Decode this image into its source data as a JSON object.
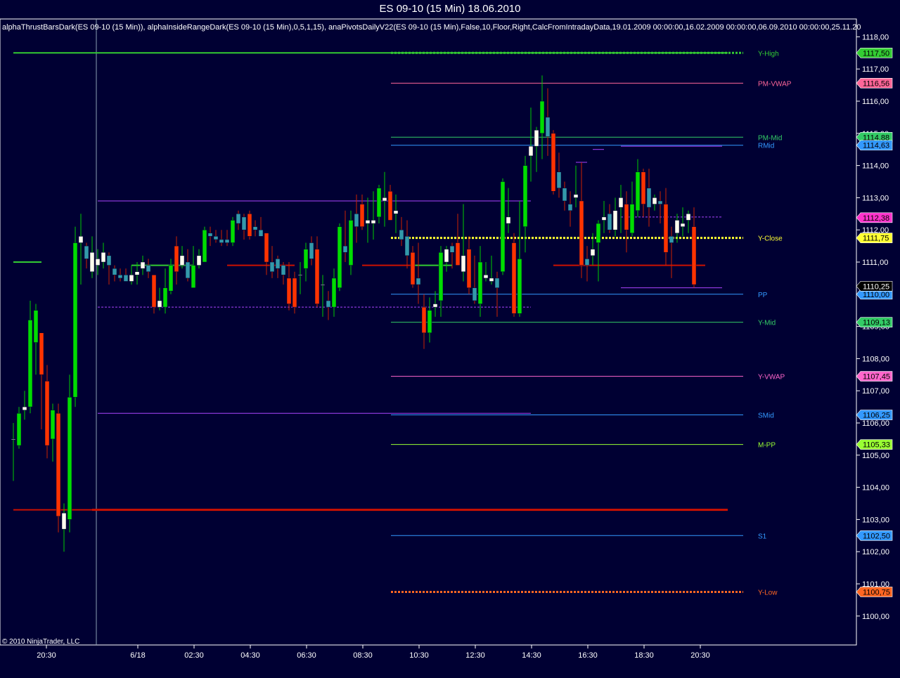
{
  "window": {
    "title": "ES 09-10 (15 Min)  18.06.2010",
    "indicator_line": "alphaThrustBarsDark(ES 09-10 (15 Min)), alphaInsideRangeDark(ES 09-10 (15 Min),0,5,1,15), anaPivotsDailyV22(ES 09-10 (15 Min),False,10,Floor,Right,CalcFromIntradayData,19.01.2009 00:00:00,16.02.2009 00:00:00,06.09.2010 00:00:00,25.11.20",
    "copyright": "© 2010 NinjaTrader, LLC"
  },
  "colors": {
    "background": "#000033",
    "axis_text": "#ffffff",
    "up_bar": "#00dd00",
    "down_bar": "#ff3300",
    "inside_up": "#ffffee",
    "neutral_bar": "#3399aa",
    "pivot_levels": {
      "Y-High": "#33cc33",
      "PM-VWAP": "#ff6699",
      "PM-Mid": "#33cc66",
      "RMid": "#3399ff",
      "Y-Close": "#ffff33",
      "PP": "#3399ff",
      "Y-Mid": "#33cc66",
      "Y-VWAP": "#ff66cc",
      "SMid": "#3399ff",
      "M-PP": "#99ff33",
      "S1": "#3399ff",
      "Y-Low": "#ff6622"
    }
  },
  "chart_data": {
    "type": "candlestick",
    "title": "ES 09-10 (15 Min)  18.06.2010",
    "ylim": [
      1099.0,
      1118.3
    ],
    "y_ticks": [
      "1118,00",
      "1117,00",
      "1116,00",
      "1115,00",
      "1114,00",
      "1113,00",
      "1112,00",
      "1111,00",
      "1110,00",
      "1109,00",
      "1108,00",
      "1107,00",
      "1106,00",
      "1105,00",
      "1104,00",
      "1103,00",
      "1102,00",
      "1101,00",
      "1100,00"
    ],
    "x_ticks": [
      "20:30",
      "6/18",
      "02:30",
      "04:30",
      "06:30",
      "08:30",
      "10:30",
      "12:30",
      "14:30",
      "16:30",
      "18:30",
      "20:30"
    ],
    "pivot_levels": [
      {
        "name": "Y-High",
        "value": 1117.5,
        "price_label": "1117,50"
      },
      {
        "name": "PM-VWAP",
        "value": 1116.56,
        "price_label": "1116,56"
      },
      {
        "name": "PM-Mid",
        "value": 1114.88,
        "price_label": "1114,88"
      },
      {
        "name": "RMid",
        "value": 1114.63,
        "price_label": "1114,63"
      },
      {
        "name": "Y-Close",
        "value": 1111.75,
        "price_label": "1111,75"
      },
      {
        "name": "PP",
        "value": 1110.0,
        "price_label": "1110,00"
      },
      {
        "name": "Y-Mid",
        "value": 1109.13,
        "price_label": "1109,13"
      },
      {
        "name": "Y-VWAP",
        "value": 1107.45,
        "price_label": "1107,45"
      },
      {
        "name": "SMid",
        "value": 1106.25,
        "price_label": "1106,25"
      },
      {
        "name": "M-PP",
        "value": 1105.33,
        "price_label": "1105,33"
      },
      {
        "name": "S1",
        "value": 1102.5,
        "price_label": "1102,50"
      },
      {
        "name": "Y-Low",
        "value": 1100.75,
        "price_label": "1100,75"
      }
    ],
    "extra_price_labels": [
      {
        "value": 1112.38,
        "price_label": "1112,38",
        "color": "#ff33cc"
      },
      {
        "value": 1110.25,
        "price_label": "1110,25",
        "color": "#000000"
      }
    ],
    "candles": [
      {
        "o": 1105.5,
        "h": 1106.0,
        "l": 1104.2,
        "c": 1105.5
      },
      {
        "o": 1105.3,
        "h": 1106.5,
        "l": 1105.2,
        "c": 1106.3
      },
      {
        "o": 1106.4,
        "h": 1107.0,
        "l": 1106.1,
        "c": 1106.5
      },
      {
        "o": 1106.5,
        "h": 1109.8,
        "l": 1106.3,
        "c": 1109.2
      },
      {
        "o": 1108.5,
        "h": 1109.7,
        "l": 1107.5,
        "c": 1109.5
      },
      {
        "o": 1108.8,
        "h": 1108.5,
        "l": 1105.8,
        "c": 1107.5
      },
      {
        "o": 1107.3,
        "h": 1107.8,
        "l": 1104.9,
        "c": 1105.3
      },
      {
        "o": 1105.5,
        "h": 1106.6,
        "l": 1104.8,
        "c": 1106.4
      },
      {
        "o": 1106.3,
        "h": 1106.6,
        "l": 1102.6,
        "c": 1103.1
      },
      {
        "o": 1102.7,
        "h": 1103.5,
        "l": 1102.0,
        "c": 1103.2
      },
      {
        "o": 1103.0,
        "h": 1107.5,
        "l": 1102.6,
        "c": 1106.8
      },
      {
        "o": 1106.8,
        "h": 1112.1,
        "l": 1106.5,
        "c": 1111.6
      },
      {
        "o": 1111.6,
        "h": 1112.5,
        "l": 1110.3,
        "c": 1111.8
      },
      {
        "o": 1111.5,
        "h": 1111.6,
        "l": 1110.8,
        "c": 1111.1
      },
      {
        "o": 1110.7,
        "h": 1111.8,
        "l": 1110.5,
        "c": 1111.3
      },
      {
        "o": 1110.9,
        "h": 1111.4,
        "l": 1110.6,
        "c": 1111.1
      },
      {
        "o": 1111.0,
        "h": 1111.6,
        "l": 1110.8,
        "c": 1111.3
      },
      {
        "o": 1111.2,
        "h": 1111.3,
        "l": 1110.3,
        "c": 1110.9
      },
      {
        "o": 1110.8,
        "h": 1110.9,
        "l": 1110.4,
        "c": 1110.6
      },
      {
        "o": 1110.6,
        "h": 1110.8,
        "l": 1110.4,
        "c": 1110.5
      },
      {
        "o": 1110.6,
        "h": 1110.8,
        "l": 1110.4,
        "c": 1110.4
      },
      {
        "o": 1110.4,
        "h": 1110.9,
        "l": 1110.3,
        "c": 1110.6
      },
      {
        "o": 1110.6,
        "h": 1111.0,
        "l": 1110.3,
        "c": 1110.7
      },
      {
        "o": 1110.8,
        "h": 1111.2,
        "l": 1110.6,
        "c": 1111.0
      },
      {
        "o": 1110.9,
        "h": 1111.1,
        "l": 1110.5,
        "c": 1110.7
      },
      {
        "o": 1110.6,
        "h": 1110.6,
        "l": 1109.4,
        "c": 1109.6
      },
      {
        "o": 1109.6,
        "h": 1110.2,
        "l": 1109.5,
        "c": 1109.8
      },
      {
        "o": 1109.6,
        "h": 1110.8,
        "l": 1109.4,
        "c": 1110.2
      },
      {
        "o": 1110.1,
        "h": 1111.1,
        "l": 1110.0,
        "c": 1110.9
      },
      {
        "o": 1111.5,
        "h": 1111.8,
        "l": 1110.3,
        "c": 1110.7
      },
      {
        "o": 1110.9,
        "h": 1111.5,
        "l": 1110.8,
        "c": 1111.2
      },
      {
        "o": 1111.0,
        "h": 1111.4,
        "l": 1110.4,
        "c": 1110.5
      },
      {
        "o": 1110.2,
        "h": 1111.5,
        "l": 1110.2,
        "c": 1110.9
      },
      {
        "o": 1110.9,
        "h": 1111.4,
        "l": 1110.8,
        "c": 1111.2
      },
      {
        "o": 1111.0,
        "h": 1112.1,
        "l": 1111.0,
        "c": 1112.0
      },
      {
        "o": 1111.9,
        "h": 1112.1,
        "l": 1111.5,
        "c": 1111.8
      },
      {
        "o": 1111.8,
        "h": 1112.0,
        "l": 1111.6,
        "c": 1111.7
      },
      {
        "o": 1111.7,
        "h": 1112.0,
        "l": 1111.5,
        "c": 1111.6
      },
      {
        "o": 1111.7,
        "h": 1112.0,
        "l": 1111.5,
        "c": 1111.6
      },
      {
        "o": 1111.6,
        "h": 1112.4,
        "l": 1111.5,
        "c": 1112.3
      },
      {
        "o": 1112.5,
        "h": 1112.6,
        "l": 1112.0,
        "c": 1112.2
      },
      {
        "o": 1112.4,
        "h": 1112.5,
        "l": 1111.7,
        "c": 1112.0
      },
      {
        "o": 1112.5,
        "h": 1112.6,
        "l": 1111.7,
        "c": 1111.8
      },
      {
        "o": 1112.1,
        "h": 1112.3,
        "l": 1111.8,
        "c": 1112.0
      },
      {
        "o": 1112.0,
        "h": 1112.4,
        "l": 1111.8,
        "c": 1111.8
      },
      {
        "o": 1111.9,
        "h": 1111.9,
        "l": 1110.6,
        "c": 1111.0
      },
      {
        "o": 1111.0,
        "h": 1111.5,
        "l": 1110.5,
        "c": 1110.7
      },
      {
        "o": 1111.1,
        "h": 1111.2,
        "l": 1110.5,
        "c": 1110.8
      },
      {
        "o": 1110.9,
        "h": 1111.0,
        "l": 1110.3,
        "c": 1110.6
      },
      {
        "o": 1110.5,
        "h": 1111.0,
        "l": 1109.5,
        "c": 1109.7
      },
      {
        "o": 1110.5,
        "h": 1110.7,
        "l": 1109.4,
        "c": 1109.6
      },
      {
        "o": 1110.6,
        "h": 1111.0,
        "l": 1110.0,
        "c": 1110.6
      },
      {
        "o": 1110.8,
        "h": 1111.6,
        "l": 1110.4,
        "c": 1111.4
      },
      {
        "o": 1111.6,
        "h": 1111.8,
        "l": 1110.9,
        "c": 1111.1
      },
      {
        "o": 1111.4,
        "h": 1111.8,
        "l": 1109.6,
        "c": 1109.7
      },
      {
        "o": 1110.3,
        "h": 1110.6,
        "l": 1109.3,
        "c": 1110.3
      },
      {
        "o": 1109.8,
        "h": 1110.1,
        "l": 1109.2,
        "c": 1109.6
      },
      {
        "o": 1109.6,
        "h": 1110.8,
        "l": 1109.3,
        "c": 1110.5
      },
      {
        "o": 1110.2,
        "h": 1112.2,
        "l": 1110.1,
        "c": 1112.1
      },
      {
        "o": 1111.5,
        "h": 1112.6,
        "l": 1111.0,
        "c": 1111.3
      },
      {
        "o": 1110.9,
        "h": 1112.6,
        "l": 1110.6,
        "c": 1112.3
      },
      {
        "o": 1112.5,
        "h": 1113.1,
        "l": 1111.6,
        "c": 1112.1
      },
      {
        "o": 1112.8,
        "h": 1113.1,
        "l": 1112.0,
        "c": 1112.1
      },
      {
        "o": 1112.2,
        "h": 1113.0,
        "l": 1111.6,
        "c": 1112.3
      },
      {
        "o": 1112.2,
        "h": 1113.2,
        "l": 1111.7,
        "c": 1112.3
      },
      {
        "o": 1112.4,
        "h": 1113.4,
        "l": 1112.2,
        "c": 1113.3
      },
      {
        "o": 1112.9,
        "h": 1113.8,
        "l": 1112.1,
        "c": 1113.0
      },
      {
        "o": 1113.2,
        "h": 1113.4,
        "l": 1112.3,
        "c": 1112.3
      },
      {
        "o": 1112.5,
        "h": 1113.1,
        "l": 1111.9,
        "c": 1112.6
      },
      {
        "o": 1112.0,
        "h": 1112.4,
        "l": 1111.5,
        "c": 1111.7
      },
      {
        "o": 1111.8,
        "h": 1112.3,
        "l": 1110.8,
        "c": 1111.2
      },
      {
        "o": 1111.3,
        "h": 1111.5,
        "l": 1110.2,
        "c": 1110.3
      },
      {
        "o": 1110.5,
        "h": 1111.6,
        "l": 1109.7,
        "c": 1110.3
      },
      {
        "o": 1109.6,
        "h": 1110.0,
        "l": 1108.3,
        "c": 1108.8
      },
      {
        "o": 1108.8,
        "h": 1109.9,
        "l": 1108.5,
        "c": 1109.5
      },
      {
        "o": 1109.6,
        "h": 1110.1,
        "l": 1109.3,
        "c": 1109.7
      },
      {
        "o": 1109.8,
        "h": 1111.5,
        "l": 1109.3,
        "c": 1111.3
      },
      {
        "o": 1111.0,
        "h": 1111.5,
        "l": 1110.7,
        "c": 1111.4
      },
      {
        "o": 1111.5,
        "h": 1111.6,
        "l": 1110.8,
        "c": 1111.3
      },
      {
        "o": 1111.6,
        "h": 1112.5,
        "l": 1110.9,
        "c": 1110.9
      },
      {
        "o": 1110.7,
        "h": 1112.8,
        "l": 1110.4,
        "c": 1111.2
      },
      {
        "o": 1111.4,
        "h": 1111.8,
        "l": 1110.0,
        "c": 1110.2
      },
      {
        "o": 1110.2,
        "h": 1111.2,
        "l": 1109.7,
        "c": 1109.8
      },
      {
        "o": 1109.7,
        "h": 1111.5,
        "l": 1109.3,
        "c": 1111.0
      },
      {
        "o": 1110.5,
        "h": 1111.0,
        "l": 1110.4,
        "c": 1110.6
      },
      {
        "o": 1110.4,
        "h": 1111.2,
        "l": 1110.3,
        "c": 1110.5
      },
      {
        "o": 1110.5,
        "h": 1110.7,
        "l": 1109.3,
        "c": 1110.2
      },
      {
        "o": 1110.7,
        "h": 1113.6,
        "l": 1110.6,
        "c": 1113.5
      },
      {
        "o": 1112.2,
        "h": 1113.3,
        "l": 1111.9,
        "c": 1112.4
      },
      {
        "o": 1111.6,
        "h": 1111.9,
        "l": 1109.3,
        "c": 1109.4
      },
      {
        "o": 1109.4,
        "h": 1112.9,
        "l": 1109.3,
        "c": 1111.1
      },
      {
        "o": 1112.1,
        "h": 1114.3,
        "l": 1111.3,
        "c": 1114.0
      },
      {
        "o": 1114.3,
        "h": 1115.8,
        "l": 1113.5,
        "c": 1114.6
      },
      {
        "o": 1114.6,
        "h": 1115.2,
        "l": 1113.8,
        "c": 1115.1
      },
      {
        "o": 1115.0,
        "h": 1116.8,
        "l": 1114.2,
        "c": 1116.0
      },
      {
        "o": 1115.5,
        "h": 1116.4,
        "l": 1114.3,
        "c": 1114.9
      },
      {
        "o": 1115.0,
        "h": 1115.1,
        "l": 1113.1,
        "c": 1113.2
      },
      {
        "o": 1113.8,
        "h": 1114.4,
        "l": 1113.0,
        "c": 1113.3
      },
      {
        "o": 1113.3,
        "h": 1113.5,
        "l": 1112.6,
        "c": 1112.9
      },
      {
        "o": 1112.8,
        "h": 1113.2,
        "l": 1112.1,
        "c": 1112.6
      },
      {
        "o": 1113.0,
        "h": 1114.0,
        "l": 1112.7,
        "c": 1113.1
      },
      {
        "o": 1112.9,
        "h": 1114.1,
        "l": 1110.5,
        "c": 1110.9
      },
      {
        "o": 1111.1,
        "h": 1111.5,
        "l": 1110.4,
        "c": 1110.9
      },
      {
        "o": 1111.2,
        "h": 1111.9,
        "l": 1110.9,
        "c": 1111.4
      },
      {
        "o": 1111.6,
        "h": 1112.3,
        "l": 1110.4,
        "c": 1112.2
      },
      {
        "o": 1112.3,
        "h": 1112.9,
        "l": 1111.9,
        "c": 1112.4
      },
      {
        "o": 1112.5,
        "h": 1112.8,
        "l": 1111.9,
        "c": 1112.0
      },
      {
        "o": 1112.0,
        "h": 1113.0,
        "l": 1111.8,
        "c": 1112.6
      },
      {
        "o": 1112.7,
        "h": 1113.4,
        "l": 1111.9,
        "c": 1113.0
      },
      {
        "o": 1112.8,
        "h": 1113.2,
        "l": 1111.3,
        "c": 1112.0
      },
      {
        "o": 1111.9,
        "h": 1113.5,
        "l": 1111.8,
        "c": 1112.8
      },
      {
        "o": 1112.6,
        "h": 1114.2,
        "l": 1112.4,
        "c": 1113.8
      },
      {
        "o": 1113.8,
        "h": 1113.9,
        "l": 1112.4,
        "c": 1112.8
      },
      {
        "o": 1113.3,
        "h": 1113.9,
        "l": 1112.1,
        "c": 1112.7
      },
      {
        "o": 1112.8,
        "h": 1113.1,
        "l": 1112.6,
        "c": 1113.0
      },
      {
        "o": 1112.9,
        "h": 1113.2,
        "l": 1112.2,
        "c": 1112.8
      },
      {
        "o": 1112.8,
        "h": 1113.3,
        "l": 1110.9,
        "c": 1111.3
      },
      {
        "o": 1111.8,
        "h": 1112.1,
        "l": 1110.5,
        "c": 1111.6
      },
      {
        "o": 1111.9,
        "h": 1112.5,
        "l": 1111.6,
        "c": 1112.3
      },
      {
        "o": 1112.1,
        "h": 1112.7,
        "l": 1111.8,
        "c": 1112.2
      },
      {
        "o": 1112.3,
        "h": 1112.6,
        "l": 1111.9,
        "c": 1112.5
      },
      {
        "o": 1112.1,
        "h": 1112.7,
        "l": 1110.2,
        "c": 1110.3
      }
    ],
    "segments": [
      {
        "x0": 0,
        "x1": 5,
        "y": 1111.0,
        "color": "#33cc33",
        "w": 2
      },
      {
        "x0": 0,
        "x1": 14,
        "y": 1103.3,
        "color": "#cc1100",
        "w": 2
      },
      {
        "x0": 14,
        "x1": 127,
        "y": 1103.3,
        "color": "#cc1100",
        "w": 3
      },
      {
        "x0": 0,
        "x1": 127,
        "y": 1117.5,
        "color": "#33cc33",
        "w": 2
      },
      {
        "x0": 15,
        "x1": 92,
        "y": 1112.9,
        "color": "#aa44ff",
        "w": 1
      },
      {
        "x0": 15,
        "x1": 92,
        "y": 1106.3,
        "color": "#aa44ff",
        "w": 1
      },
      {
        "x0": 15,
        "x1": 92,
        "y": 1109.6,
        "color": "#aa44ff",
        "w": 1,
        "dash": "3,2"
      },
      {
        "x0": 21,
        "x1": 32,
        "y": 1110.9,
        "color": "#33cc33",
        "w": 2
      },
      {
        "x0": 38,
        "x1": 50,
        "y": 1110.9,
        "color": "#cc1100",
        "w": 2
      },
      {
        "x0": 62,
        "x1": 72,
        "y": 1110.9,
        "color": "#cc1100",
        "w": 2
      },
      {
        "x0": 71,
        "x1": 78,
        "y": 1110.9,
        "color": "#33cc33",
        "w": 2
      },
      {
        "x0": 96,
        "x1": 123,
        "y": 1110.9,
        "color": "#cc1100",
        "w": 2
      },
      {
        "x0": 108,
        "x1": 126,
        "y": 1110.2,
        "color": "#aa44ff",
        "w": 1
      },
      {
        "x0": 108,
        "x1": 126,
        "y": 1112.4,
        "color": "#aa44ff",
        "w": 1,
        "dash": "3,2"
      },
      {
        "x0": 108,
        "x1": 126,
        "y": 1114.6,
        "color": "#aa44ff",
        "w": 1
      },
      {
        "x0": 103,
        "x1": 105,
        "y": 1114.5,
        "color": "#aa44ff",
        "w": 1
      },
      {
        "x0": 100,
        "x1": 102,
        "y": 1114.1,
        "color": "#aa44ff",
        "w": 1
      }
    ]
  }
}
